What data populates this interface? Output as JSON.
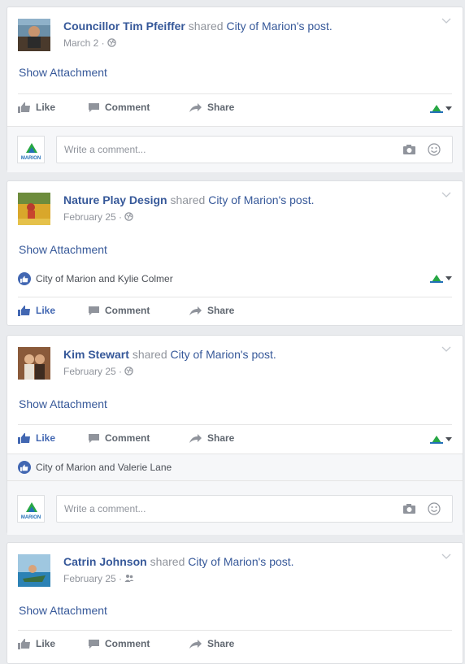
{
  "colors": {
    "link": "#365899",
    "like_active": "#4267b2",
    "muted": "#90949c",
    "logo_green": "#27a744",
    "logo_blue": "#2470b8"
  },
  "common": {
    "shared_text": "shared",
    "post_suffix": "'s post.",
    "show_attachment": "Show Attachment",
    "like": "Like",
    "comment": "Comment",
    "share": "Share",
    "comment_placeholder": "Write a comment...",
    "marion_logo_text": "MARION",
    "source_page": "City of Marion"
  },
  "posts": [
    {
      "actor": "Councillor Tim Pfeiffer",
      "date": "March 2 ·",
      "audience_icon": "globe-icon",
      "liked": false
    },
    {
      "actor": "Nature Play Design",
      "date": "February 25 ·",
      "audience_icon": "globe-icon",
      "liked": true,
      "reactions": "City of Marion and Kylie Colmer"
    },
    {
      "actor": "Kim Stewart",
      "date": "February 25 ·",
      "audience_icon": "globe-icon",
      "liked": true,
      "reactions": "City of Marion and Valerie Lane"
    },
    {
      "actor": "Catrin Johnson",
      "date": "February 25 ·",
      "audience_icon": "friends-icon",
      "liked": false
    }
  ]
}
